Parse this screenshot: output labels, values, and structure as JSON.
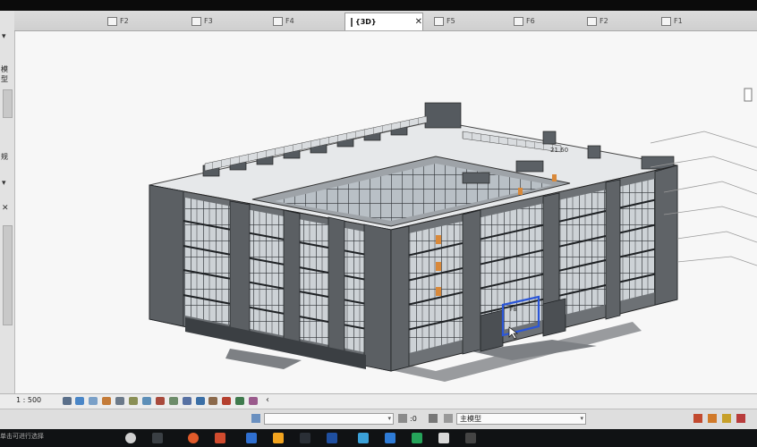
{
  "tabs": [
    {
      "label": "F2",
      "active": false
    },
    {
      "label": "F3",
      "active": false
    },
    {
      "label": "F4",
      "active": false
    },
    {
      "label": "{3D}",
      "active": true
    },
    {
      "label": "F5",
      "active": false
    },
    {
      "label": "F6",
      "active": false
    },
    {
      "label": "F2",
      "active": false
    },
    {
      "label": "F1",
      "active": false
    }
  ],
  "tab_close_glyph": "✕",
  "left_panel": {
    "label_top": "模型",
    "label_bottom": "规",
    "arrow_glyph": "▾",
    "close_glyph": "✕"
  },
  "view_control": {
    "scale": "1 : 500",
    "collapse_glyph": "‹"
  },
  "status_bar": {
    "selection_value": "",
    "filter_count": ":0",
    "model_label": "主模型",
    "left_text": "单击可进行选择"
  },
  "colors": {
    "accent_blue": "#2b56d8",
    "building_gray": "#5f6266",
    "glass": "#c9cfd4"
  },
  "icons": [
    "window-icon",
    "tab-view-icon",
    "grid-icon",
    "wireframe-icon",
    "shadow-icon",
    "sun-icon",
    "crop-icon",
    "hide-icon",
    "lock-icon",
    "temp-icon",
    "filter-icon",
    "windows-icon",
    "chrome-icon"
  ]
}
